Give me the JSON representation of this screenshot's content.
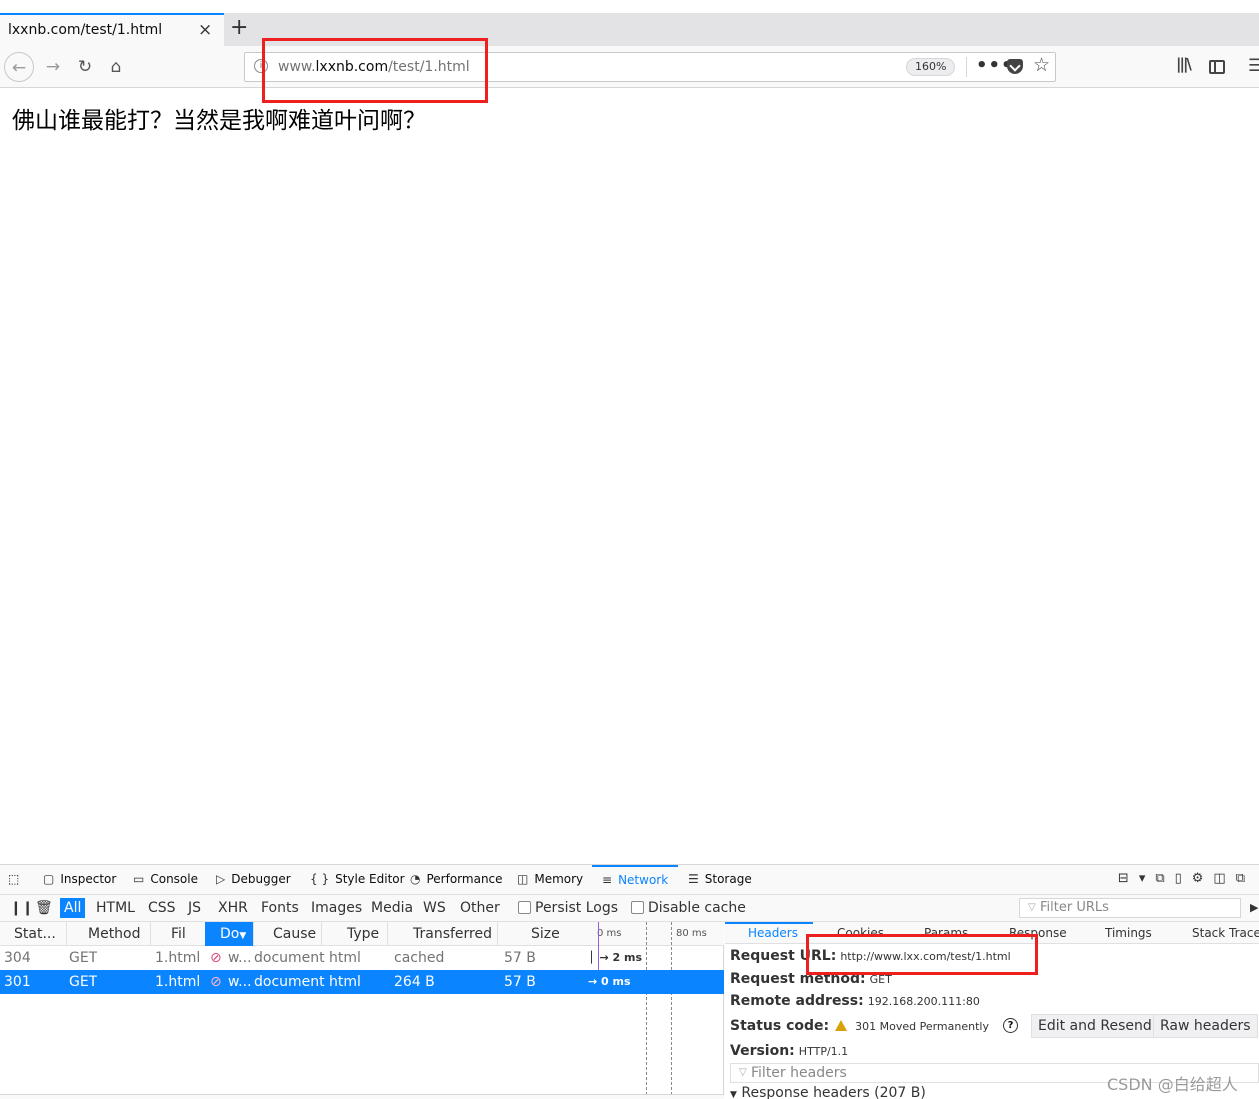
{
  "browser": {
    "tab_title": "lxxnb.com/test/1.html",
    "tab_close": "×",
    "new_tab": "+",
    "url_prefix": "www.",
    "url_host": "lxxnb.com",
    "url_path": "/test/1.html",
    "zoom": "160%",
    "page_actions": "•••"
  },
  "page": {
    "text": "佛山谁最能打？当然是我啊难道叶问啊？"
  },
  "devtools": {
    "tabs": [
      {
        "label": "Inspector",
        "icon": "inspector-icon"
      },
      {
        "label": "Console",
        "icon": "console-icon"
      },
      {
        "label": "Debugger",
        "icon": "debugger-icon"
      },
      {
        "label": "Style Editor",
        "icon": "style-editor-icon"
      },
      {
        "label": "Performance",
        "icon": "performance-icon"
      },
      {
        "label": "Memory",
        "icon": "memory-icon"
      },
      {
        "label": "Network",
        "icon": "network-icon"
      },
      {
        "label": "Storage",
        "icon": "storage-icon"
      }
    ],
    "active_tab": "Network",
    "filters": [
      "All",
      "HTML",
      "CSS",
      "JS",
      "XHR",
      "Fonts",
      "Images",
      "Media",
      "WS",
      "Other"
    ],
    "active_filter": "All",
    "persist_logs": "Persist Logs",
    "disable_cache": "Disable cache",
    "filter_urls_placeholder": "Filter URLs",
    "columns": [
      "Stat...",
      "Method",
      "Fil",
      "Do",
      "Cause",
      "Type",
      "Transferred",
      "Size",
      "0 ms",
      "80 ms"
    ],
    "rows": [
      {
        "status": "304",
        "method": "GET",
        "file": "1.html",
        "domain": "w...",
        "cause": "document",
        "type": "html",
        "transferred": "cached",
        "size": "57 B",
        "timing": "2 ms"
      },
      {
        "status": "301",
        "method": "GET",
        "file": "1.html",
        "domain": "w...",
        "cause": "document",
        "type": "html",
        "transferred": "264 B",
        "size": "57 B",
        "timing": "0 ms"
      }
    ],
    "selected_row_index": 1,
    "details": {
      "tabs": [
        "Headers",
        "Cookies",
        "Params",
        "Response",
        "Timings",
        "Stack Trace"
      ],
      "active_tab": "Headers",
      "request_url_label": "Request URL:",
      "request_url": "http://www.lxx.com/test/1.html",
      "request_method_label": "Request method:",
      "request_method": "GET",
      "remote_address_label": "Remote address:",
      "remote_address": "192.168.200.111:80",
      "status_code_label": "Status code:",
      "status_code": "301 Moved Permanently",
      "version_label": "Version:",
      "version": "HTTP/1.1",
      "edit_resend": "Edit and Resend",
      "raw_headers": "Raw headers",
      "filter_headers_placeholder": "Filter headers",
      "response_headers": "Response headers (207 B)"
    }
  },
  "watermark": "CSDN @白给超人",
  "colors": {
    "accent": "#0a84ff",
    "highlight": "#ee1f1f",
    "warning": "#d7a10a"
  }
}
